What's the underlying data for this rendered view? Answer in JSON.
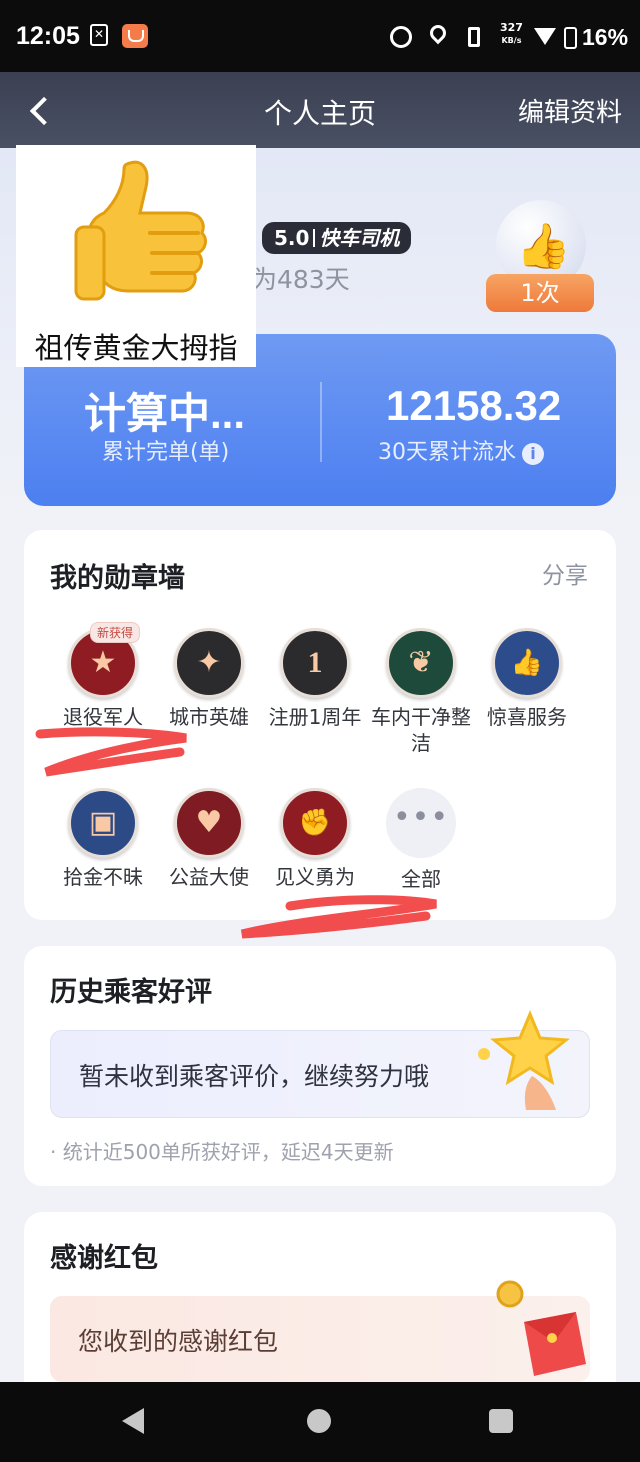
{
  "status_bar": {
    "time": "12:05",
    "speed_value": "327",
    "speed_unit": "KB/s",
    "battery": "16%",
    "notif_glyph": "✕"
  },
  "header": {
    "title": "个人主页",
    "edit_label": "编辑资料",
    "back_icon": "chevron-left-icon"
  },
  "profile": {
    "meme_caption": "祖传黄金大拇指",
    "rating": "5.0",
    "role": "快车司机",
    "days": "为483天",
    "like_count": "1次"
  },
  "stats": {
    "orders_value": "计算中...",
    "orders_label": "累计完单(单)",
    "flow_value": "12158.32",
    "flow_label": "30天累计流水",
    "info_glyph": "i"
  },
  "medals": {
    "title": "我的勋章墙",
    "share_label": "分享",
    "new_tag": "新获得",
    "items": [
      {
        "name": "退役军人",
        "icon": "star-icon",
        "glyph": "★",
        "bg": "#8e1c22"
      },
      {
        "name": "城市英雄",
        "icon": "wings-emblem-icon",
        "glyph": "✦",
        "bg": "#2b2b2e"
      },
      {
        "name": "注册1周年",
        "icon": "number-one-icon",
        "glyph": "1",
        "bg": "#2b2b2e"
      },
      {
        "name": "车内干净整洁",
        "icon": "leaf-icon",
        "glyph": "❦",
        "bg": "#1e4a3c"
      },
      {
        "name": "惊喜服务",
        "icon": "thumbs-up-icon",
        "glyph": "👍",
        "bg": "#2d4c8c"
      },
      {
        "name": "拾金不昧",
        "icon": "wallet-icon",
        "glyph": "▣",
        "bg": "#2c4a86"
      },
      {
        "name": "公益大使",
        "icon": "heart-icon",
        "glyph": "♥",
        "bg": "#7f1b22"
      },
      {
        "name": "见义勇为",
        "icon": "strong-arm-icon",
        "glyph": "✊",
        "bg": "#8e1c22"
      },
      {
        "name": "全部",
        "icon": "more-dots-icon",
        "glyph": "•••",
        "bg": "#eef0f5"
      }
    ]
  },
  "reviews": {
    "title": "历史乘客好评",
    "empty_text": "暂未收到乘客评价，继续努力哦",
    "note": "· 统计近500单所获好评，延迟4天更新"
  },
  "hongbao": {
    "title": "感谢红包",
    "box_text": "您收到的感谢红包"
  },
  "colors": {
    "accent_blue": "#4c7ff0",
    "scribble_red": "#f23b3b",
    "like_orange": "#ee7a3a"
  }
}
